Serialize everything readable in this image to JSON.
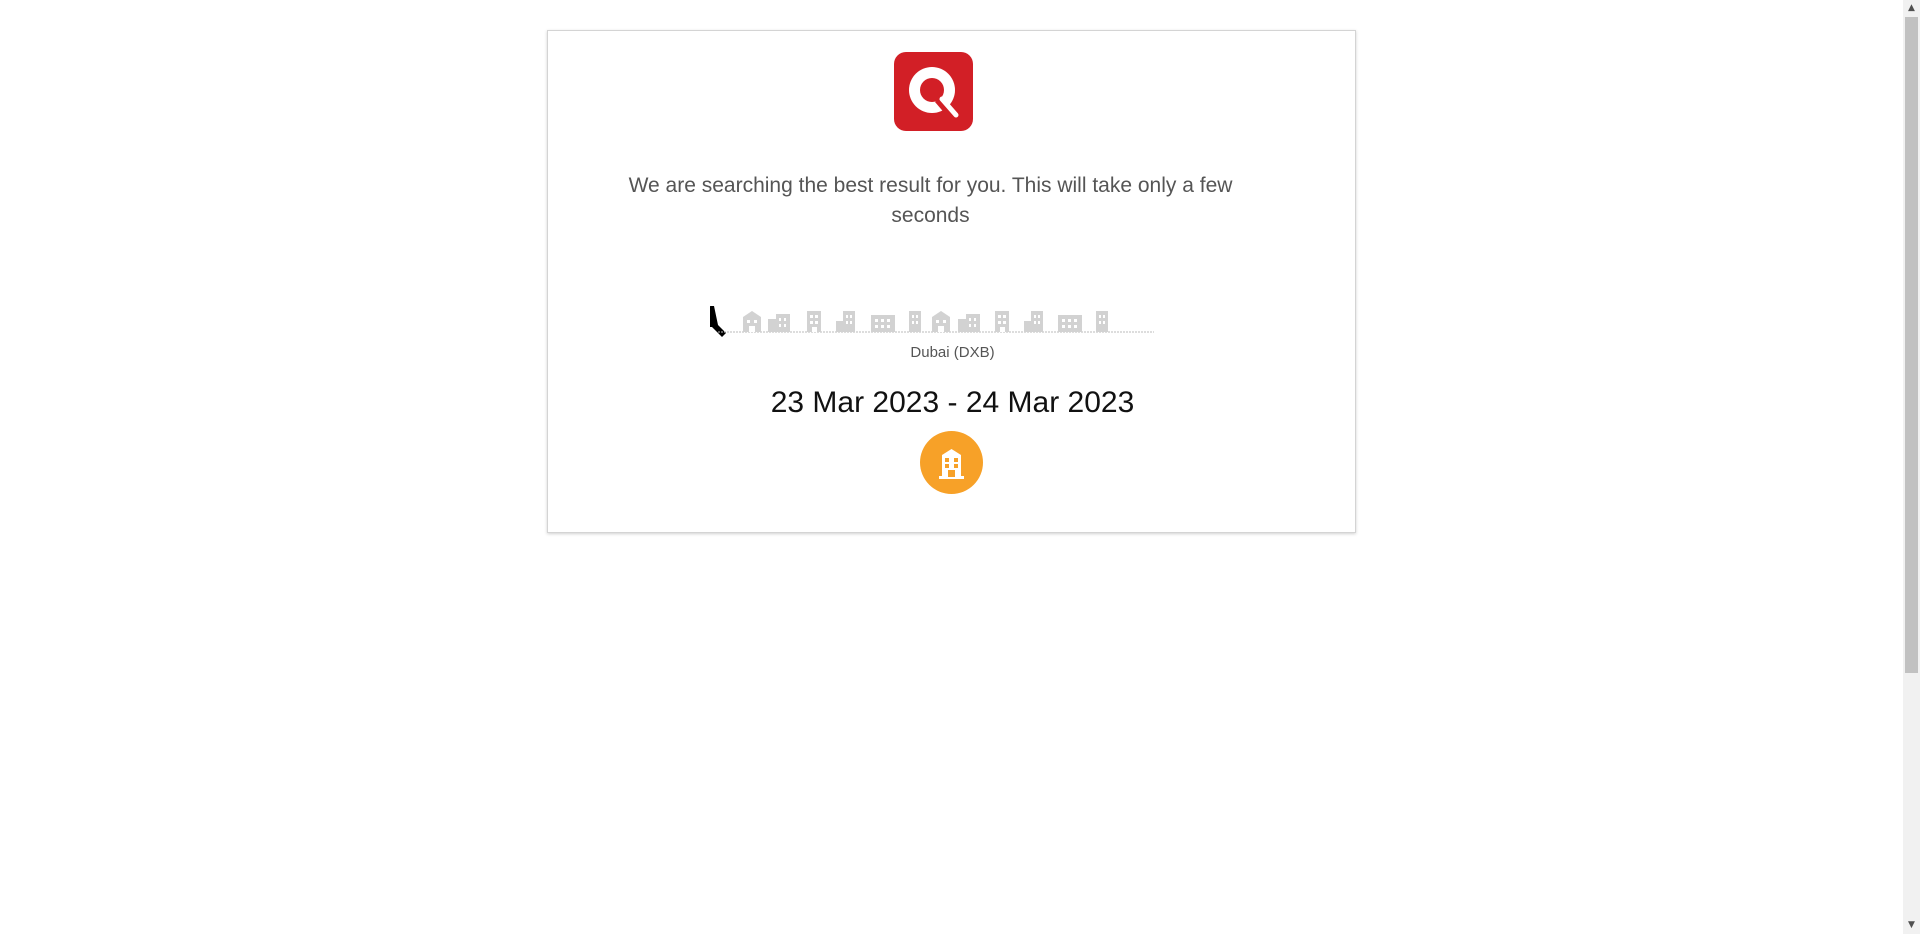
{
  "loading": {
    "message": "We are searching the best result for you. This will take only a few seconds"
  },
  "search": {
    "city": "Dubai (DXB)",
    "dates": "23 Mar 2023 - 24 Mar 2023"
  },
  "icons": {
    "logo": "search-q-logo-icon",
    "skyline": "hotel-skyline-icon",
    "walker": "walking-figure-icon",
    "hotel": "hotel-building-icon"
  },
  "colors": {
    "brand_red": "#d21f26",
    "accent_orange": "#f7a128",
    "text_gray": "#555555",
    "skyline_gray": "#cfcfcf"
  }
}
